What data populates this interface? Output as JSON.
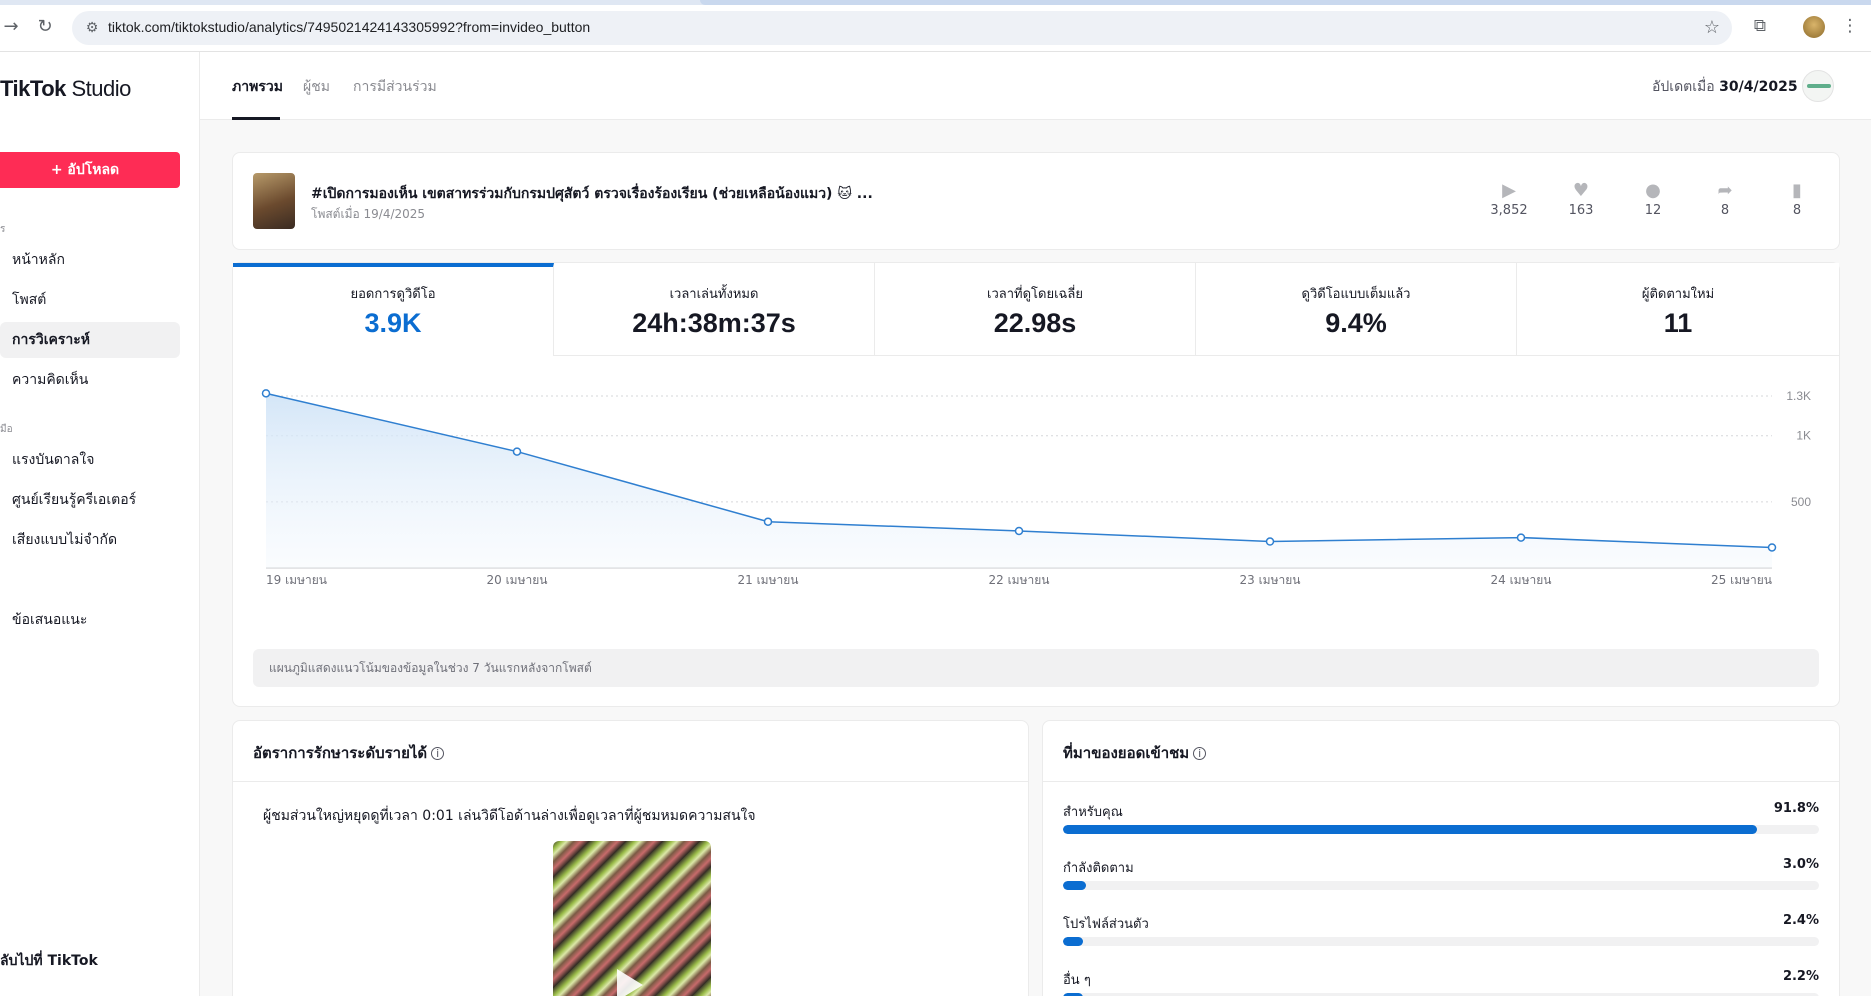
{
  "browser": {
    "url": "tiktok.com/tiktokstudio/analytics/7495021424143305992?from=invideo_button"
  },
  "sidebar": {
    "brand": "TikTok",
    "brand_sub": "Studio",
    "upload_label": "+ อัปโหลด",
    "section_manage": "ร",
    "section_tools": "มือ",
    "items": [
      {
        "label": "หน้าหลัก"
      },
      {
        "label": "โพสต์"
      },
      {
        "label": "การวิเคราะห์"
      },
      {
        "label": "ความคิดเห็น"
      },
      {
        "label": "แรงบันดาลใจ"
      },
      {
        "label": "ศูนย์เรียนรู้ครีเอเตอร์"
      },
      {
        "label": "เสียงแบบไม่จำกัด"
      },
      {
        "label": "ข้อเสนอแนะ"
      }
    ],
    "back_label": "ลับไปที่ TikTok"
  },
  "topbar": {
    "tabs": [
      {
        "label": "ภาพรวม"
      },
      {
        "label": "ผู้ชม"
      },
      {
        "label": "การมีส่วนร่วม"
      }
    ],
    "updated_prefix": "อัปเดตเมื่อ",
    "updated_date": "30/4/2025"
  },
  "video": {
    "title": "#เปิดการมองเห็น เขตสาทรร่วมกับกรมปศุสัตว์ ตรวจเรื่องร้องเรียน (ช่วยเหลือน้องแมว) 🐱 ...",
    "posted": "โพสต์เมื่อ 19/4/2025",
    "stats": [
      {
        "icon": "play-icon",
        "value": "3,852"
      },
      {
        "icon": "heart-icon",
        "value": "163"
      },
      {
        "icon": "comment-icon",
        "value": "12"
      },
      {
        "icon": "share-icon",
        "value": "8"
      },
      {
        "icon": "bookmark-icon",
        "value": "8"
      }
    ]
  },
  "metrics": [
    {
      "label": "ยอดการดูวิดีโอ",
      "value": "3.9K"
    },
    {
      "label": "เวลาเล่นทั้งหมด",
      "value": "24h:38m:37s"
    },
    {
      "label": "เวลาที่ดูโดยเฉลี่ย",
      "value": "22.98s"
    },
    {
      "label": "ดูวิดีโอแบบเต็มแล้ว",
      "value": "9.4%"
    },
    {
      "label": "ผู้ติดตามใหม่",
      "value": "11"
    }
  ],
  "chart_data": {
    "type": "area",
    "categories": [
      "19 เมษายน",
      "20 เมษายน",
      "21 เมษายน",
      "22 เมษายน",
      "23 เมษายน",
      "24 เมษายน",
      "25 เมษายน"
    ],
    "values": [
      1320,
      880,
      350,
      280,
      200,
      230,
      155
    ],
    "yticks": [
      {
        "value": 1300,
        "label": "1.3K"
      },
      {
        "value": 1000,
        "label": "1K"
      },
      {
        "value": 500,
        "label": "500"
      }
    ],
    "ylim": [
      0,
      1400
    ],
    "grid": true,
    "color": "#2f7fd0",
    "note": "แผนภูมิแสดงแนวโน้มของข้อมูลในช่วง 7 วันแรกหลังจากโพสต์"
  },
  "retention": {
    "title": "อัตราการรักษาระดับรายได้",
    "text": "ผู้ชมส่วนใหญ่หยุดดูที่เวลา 0:01 เล่นวิดีโอด้านล่างเพื่อดูเวลาที่ผู้ชมหมดความสนใจ"
  },
  "traffic": {
    "title": "ที่มาของยอดเข้าชม",
    "sources": [
      {
        "label": "สำหรับคุณ",
        "pct_text": "91.8%",
        "pct": 91.8
      },
      {
        "label": "กำลังติดตาม",
        "pct_text": "3.0%",
        "pct": 3.0
      },
      {
        "label": "โปรไฟล์ส่วนตัว",
        "pct_text": "2.4%",
        "pct": 2.4
      },
      {
        "label": "อื่น ๆ",
        "pct_text": "2.2%",
        "pct": 2.2
      }
    ]
  }
}
